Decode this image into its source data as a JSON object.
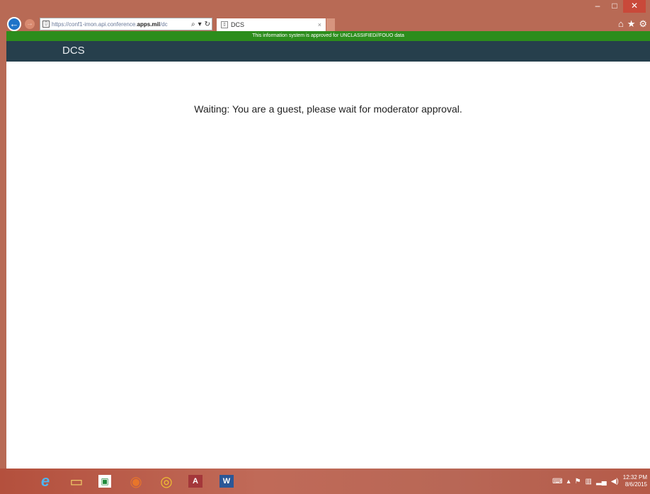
{
  "browser": {
    "url": "https://conf1-imon.api.conference.",
    "url_domain": "apps.mil",
    "url_tail": "/dc",
    "tab_title": "DCS",
    "back_glyph": "←",
    "forward_glyph": "→",
    "search_glyph": "⌕",
    "dropdown_glyph": "▾",
    "refresh_glyph": "↻",
    "close_tab_glyph": "×",
    "home_glyph": "⌂",
    "favorites_glyph": "★",
    "settings_glyph": "⚙"
  },
  "window_controls": {
    "minimize": "–",
    "maximize": "□",
    "close": "✕"
  },
  "page": {
    "banner": "This information system is approved for UNCLASSIFIED//FOUO data",
    "app_title": "DCS",
    "waiting_message": "Waiting: You are a guest, please wait for moderator approval."
  },
  "taskbar": {
    "pinned": [
      {
        "icon": "internet-explorer-icon",
        "glyph": "e"
      },
      {
        "icon": "file-explorer-icon",
        "glyph": "▭"
      },
      {
        "icon": "store-icon",
        "glyph": "▣"
      },
      {
        "icon": "firefox-icon",
        "glyph": "◉"
      },
      {
        "icon": "chrome-icon",
        "glyph": "◎"
      },
      {
        "icon": "access-icon",
        "glyph": "A"
      },
      {
        "icon": "word-icon",
        "glyph": "W"
      }
    ],
    "clock_time": "12:32 PM",
    "clock_date": "8/6/2015"
  },
  "colors": {
    "banner": "#2c8d1c",
    "app_header": "#263f4c",
    "window_frame": "#b86a55"
  }
}
